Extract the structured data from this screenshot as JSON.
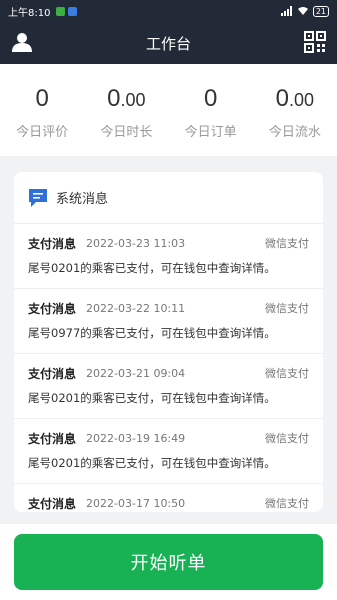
{
  "status_bar": {
    "time": "上午8:10",
    "battery": "21"
  },
  "header": {
    "title": "工作台",
    "user_icon": "user-icon",
    "qr_icon": "qr-code-icon"
  },
  "stats": [
    {
      "value": "0",
      "decimals": "",
      "label": "今日评价"
    },
    {
      "value": "0",
      "decimals": ".00",
      "label": "今日时长"
    },
    {
      "value": "0",
      "decimals": "",
      "label": "今日订单"
    },
    {
      "value": "0",
      "decimals": ".00",
      "label": "今日流水"
    }
  ],
  "messages_card": {
    "title": "系统消息",
    "items": [
      {
        "kind": "支付消息",
        "date": "2022-03-23 11:03",
        "channel": "微信支付",
        "text": "尾号0201的乘客已支付，可在钱包中查询详情。"
      },
      {
        "kind": "支付消息",
        "date": "2022-03-22 10:11",
        "channel": "微信支付",
        "text": "尾号0977的乘客已支付，可在钱包中查询详情。"
      },
      {
        "kind": "支付消息",
        "date": "2022-03-21 09:04",
        "channel": "微信支付",
        "text": "尾号0201的乘客已支付，可在钱包中查询详情。"
      },
      {
        "kind": "支付消息",
        "date": "2022-03-19 16:49",
        "channel": "微信支付",
        "text": "尾号0201的乘客已支付，可在钱包中查询详情。"
      },
      {
        "kind": "支付消息",
        "date": "2022-03-17 10:50",
        "channel": "微信支付",
        "text": ""
      }
    ]
  },
  "start_button": {
    "label": "开始听单"
  },
  "colors": {
    "header_bg": "#232a37",
    "primary_green": "#18b254",
    "message_icon": "#2f6fd6"
  }
}
